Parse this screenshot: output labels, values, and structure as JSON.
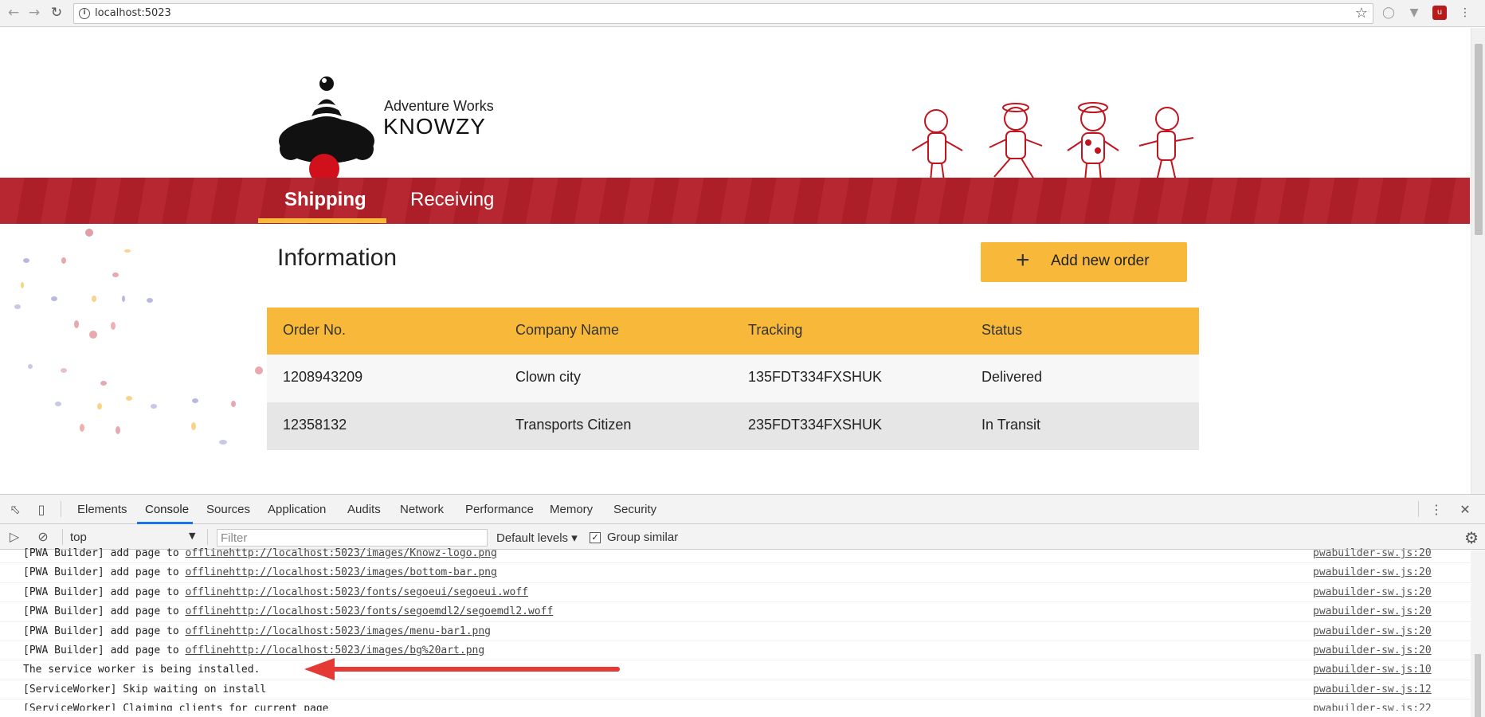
{
  "browser": {
    "url": "localhost:5023",
    "back_icon": "arrow-left-icon",
    "forward_icon": "arrow-right-icon",
    "reload_icon": "reload-icon"
  },
  "site": {
    "brand_line1": "Adventure Works",
    "brand_line2": "KNOWZY",
    "nav": [
      {
        "label": "Shipping",
        "active": true
      },
      {
        "label": "Receiving",
        "active": false
      }
    ],
    "section_title": "Information",
    "add_button": {
      "icon": "+",
      "label": "Add new order"
    },
    "colors": {
      "menubar": "#b4202a",
      "accent": "#f8b93a"
    },
    "table": {
      "headers": [
        "Order No.",
        "Company Name",
        "Tracking",
        "Status"
      ],
      "rows": [
        [
          "1208943209",
          "Clown city",
          "135FDT334FXSHUK",
          "Delivered"
        ],
        [
          "12358132",
          "Transports Citizen",
          "235FDT334FXSHUK",
          "In Transit"
        ]
      ]
    }
  },
  "devtools": {
    "tabs": [
      "Elements",
      "Console",
      "Sources",
      "Application",
      "Audits",
      "Network",
      "Performance",
      "Memory",
      "Security"
    ],
    "active_tab": "Console",
    "context": "top",
    "filter_placeholder": "Filter",
    "levels": "Default levels",
    "group_similar": "Group similar",
    "logs": [
      {
        "prefix": "[PWA Builder] add page to ",
        "link": "offlinehttp://localhost:5023/images/Knowz-logo.png",
        "source": "pwabuilder-sw.js:20"
      },
      {
        "prefix": "[PWA Builder] add page to ",
        "link": "offlinehttp://localhost:5023/images/bottom-bar.png",
        "source": "pwabuilder-sw.js:20"
      },
      {
        "prefix": "[PWA Builder] add page to ",
        "link": "offlinehttp://localhost:5023/fonts/segoeui/segoeui.woff",
        "source": "pwabuilder-sw.js:20"
      },
      {
        "prefix": "[PWA Builder] add page to ",
        "link": "offlinehttp://localhost:5023/fonts/segoemdl2/segoemdl2.woff",
        "source": "pwabuilder-sw.js:20"
      },
      {
        "prefix": "[PWA Builder] add page to ",
        "link": "offlinehttp://localhost:5023/images/menu-bar1.png",
        "source": "pwabuilder-sw.js:20"
      },
      {
        "prefix": "[PWA Builder] add page to ",
        "link": "offlinehttp://localhost:5023/images/bg%20art.png",
        "source": "pwabuilder-sw.js:20"
      },
      {
        "prefix": "The service worker is being installed.",
        "link": "",
        "source": "pwabuilder-sw.js:10"
      },
      {
        "prefix": "[ServiceWorker] Skip waiting on install",
        "link": "",
        "source": "pwabuilder-sw.js:12"
      },
      {
        "prefix": "[ServiceWorker] Claiming clients for current page",
        "link": "",
        "source": "pwabuilder-sw.js:22"
      }
    ]
  }
}
